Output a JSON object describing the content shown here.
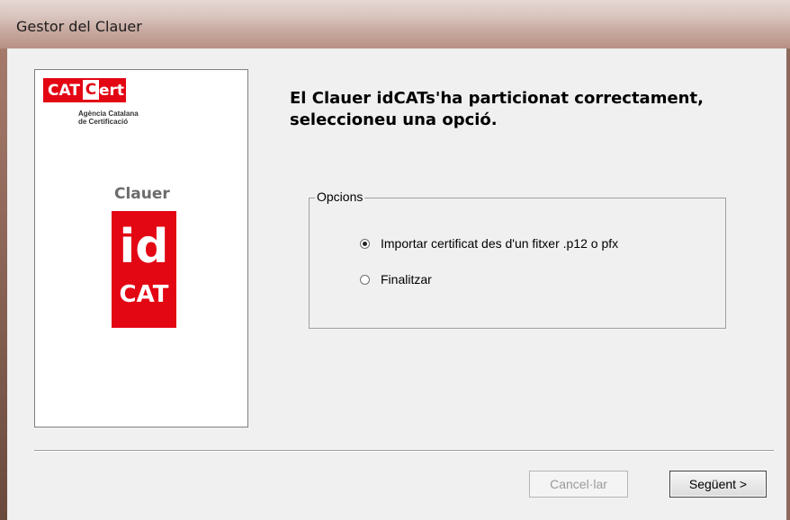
{
  "window": {
    "title": "Gestor del Clauer"
  },
  "branding": {
    "catcert_cat": "CAT",
    "catcert_c": "C",
    "catcert_ert": "ert",
    "agency_line1": "Agència Catalana",
    "agency_line2": "de Certificació",
    "clauer_word": "Clauer",
    "idcat_id": "id",
    "idcat_cat": "CAT",
    "brand_red": "#e30613"
  },
  "main": {
    "heading_line1": "El  Clauer idCATs'ha particionat correctament,",
    "heading_line2": "seleccioneu una opció."
  },
  "options": {
    "legend": "Opcions",
    "items": [
      {
        "label": "Importar certificat des d'un fitxer .p12 o pfx",
        "selected": true
      },
      {
        "label": "Finalitzar",
        "selected": false
      }
    ]
  },
  "buttons": {
    "cancel_label": "Cancel·lar",
    "next_label": "Següent >"
  }
}
